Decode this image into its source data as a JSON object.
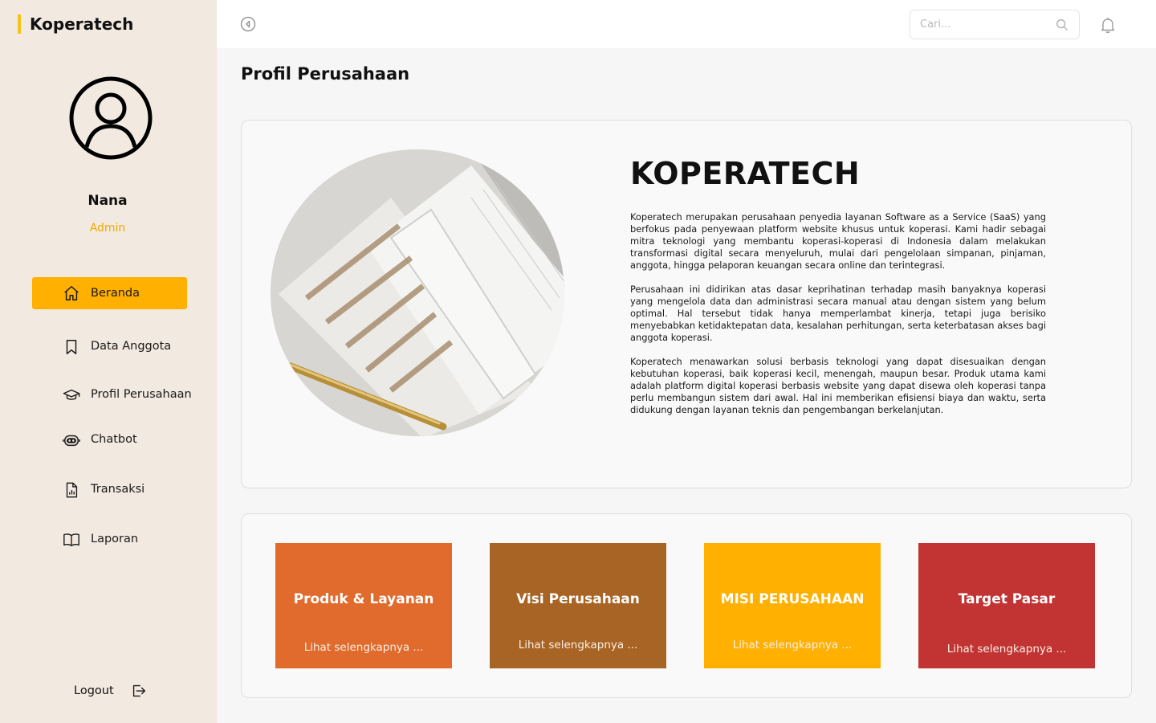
{
  "app": {
    "brand": "Koperatech"
  },
  "user": {
    "name": "Nana",
    "role": "Admin"
  },
  "sidebar": {
    "items": [
      {
        "label": "Beranda",
        "icon": "home-icon",
        "active": true
      },
      {
        "label": "Data Anggota",
        "icon": "bookmark-icon"
      },
      {
        "label": "Profil Perusahaan",
        "icon": "graduation-cap-icon"
      },
      {
        "label": "Chatbot",
        "icon": "bot-icon"
      },
      {
        "label": "Transaksi",
        "icon": "report-file-icon"
      },
      {
        "label": "Laporan",
        "icon": "book-icon"
      }
    ],
    "logout_label": "Logout"
  },
  "topbar": {
    "search_placeholder": "Cari..."
  },
  "page": {
    "title": "Profil Perusahaan"
  },
  "profile": {
    "company_name": "KOPERATECH",
    "paragraphs": [
      "Koperatech merupakan perusahaan penyedia layanan Software as a Service (SaaS) yang berfokus pada penyewaan platform website khusus untuk koperasi. Kami hadir sebagai mitra teknologi yang membantu koperasi-koperasi di Indonesia dalam melakukan transformasi digital secara menyeluruh, mulai dari pengelolaan simpanan, pinjaman, anggota, hingga pelaporan keuangan secara online dan terintegrasi.",
      "Perusahaan ini didirikan atas dasar keprihatinan terhadap masih banyaknya koperasi yang mengelola data dan administrasi secara manual atau dengan sistem yang belum optimal. Hal tersebut tidak hanya memperlambat kinerja, tetapi juga berisiko menyebabkan ketidaktepatan data, kesalahan perhitungan, serta keterbatasan akses bagi anggota koperasi.",
      "Koperatech menawarkan solusi berbasis teknologi yang dapat disesuaikan dengan kebutuhan koperasi, baik koperasi kecil, menengah, maupun besar. Produk utama kami adalah platform digital koperasi berbasis website yang dapat disewa oleh koperasi tanpa perlu membangun sistem dari awal. Hal ini memberikan efisiensi biaya dan waktu, serta didukung dengan layanan teknis dan pengembangan berkelanjutan."
    ]
  },
  "tiles": [
    {
      "title": "Produk & Layanan",
      "link": "Lihat selengkapnya ...",
      "color": "#e06b2d"
    },
    {
      "title": "Visi Perusahaan",
      "link": "Lihat selengkapnya ...",
      "color": "#a86424"
    },
    {
      "title": "MISI PERUSAHAAN",
      "link": "Lihat selengkapnya ...",
      "color": "#ffb000"
    },
    {
      "title": "Target Pasar",
      "link": "Lihat selengkapnya ...",
      "color": "#c23434"
    }
  ],
  "colors": {
    "accent": "#ffb000",
    "sidebar_bg": "#f2e9e0",
    "role_text": "#f2aa00",
    "brand_bar": "#f5c31d"
  }
}
